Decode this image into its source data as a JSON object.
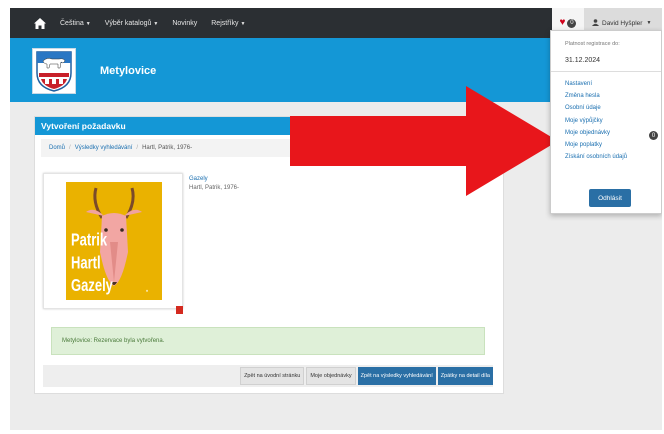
{
  "navbar": {
    "items": [
      {
        "label": "Čeština",
        "has_caret": true
      },
      {
        "label": "Výběr katalogů",
        "has_caret": true
      },
      {
        "label": "Novinky",
        "has_caret": false
      },
      {
        "label": "Rejstříky",
        "has_caret": true
      }
    ],
    "favorites_count": "0",
    "user_name": "David Hyšpler"
  },
  "header": {
    "site_name": "Metylovice"
  },
  "panel": {
    "title": "Vytvoření požadavku",
    "breadcrumb": [
      "Domů",
      "Výsledky vyhledávání",
      "Hartl, Patrik, 1976-"
    ]
  },
  "book": {
    "title": "Gazely",
    "author": "Hartl, Patrik, 1976-",
    "cover_author": "Patrik Hartl",
    "cover_title": "Gazely"
  },
  "alert": {
    "text": "Metylovice: Rezervace byla vytvořena."
  },
  "buttons": {
    "home": "Zpět na úvodní stránku",
    "my_orders": "Moje objednávky",
    "back_results": "Zpět na výsledky vyhledávání",
    "back_detail": "Zpátky na detail díla"
  },
  "dropdown": {
    "validity_label": "Platnost registrace do:",
    "validity_date": "31.12.2024",
    "items": [
      "Nastavení",
      "Změna hesla",
      "Osobní údaje",
      "Moje výpůjčky",
      "Moje objednávky",
      "Moje poplatky",
      "Získání osobních údajů"
    ],
    "orders_badge": "0",
    "logout": "Odhlásit"
  },
  "colors": {
    "navbar": "#2b2f33",
    "header_blue": "#1497d6",
    "primary_button": "#2a6fa5",
    "arrow_red": "#e8161b",
    "alert_green": "#dff0d8"
  }
}
